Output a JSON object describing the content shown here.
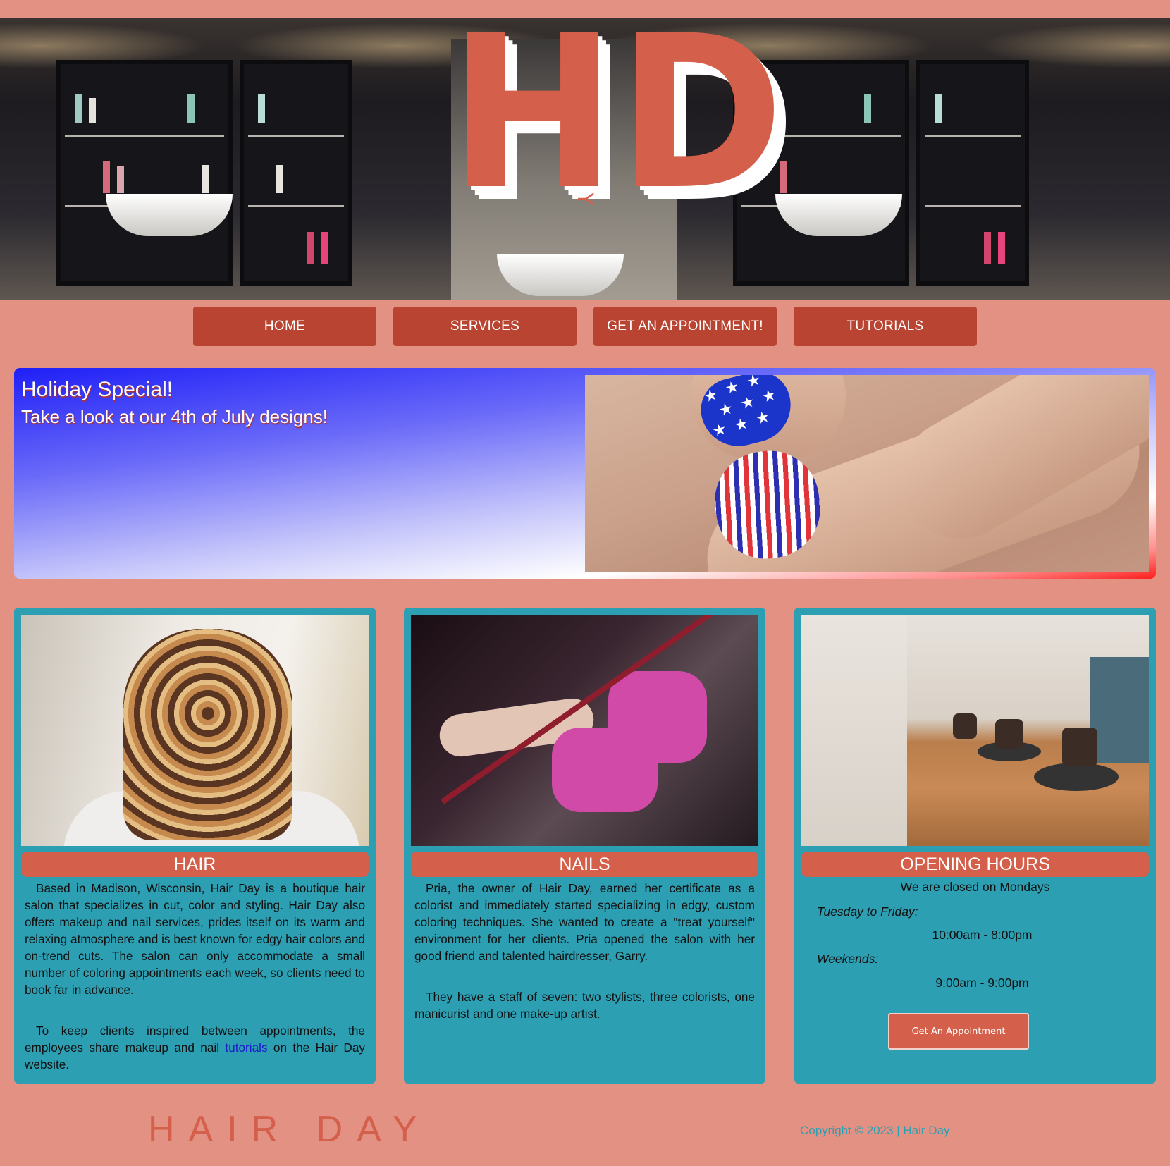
{
  "brand": {
    "logo_h": "H",
    "logo_d": "D",
    "logo_sub": "HAIR DAY"
  },
  "nav": [
    {
      "label": "HOME"
    },
    {
      "label": "SERVICES"
    },
    {
      "label": "GET AN APPOINTMENT!"
    },
    {
      "label": "TUTORIALS"
    }
  ],
  "promo": {
    "title": "Holiday Special!",
    "subtitle": "Take a look at our 4th of July designs!"
  },
  "hair": {
    "heading": "HAIR",
    "p1": "Based in Madison, Wisconsin, Hair Day is a boutique hair salon that specializes in cut, color and styling. Hair Day also offers makeup and nail services, prides itself on its warm and relaxing atmosphere and is best known for edgy hair colors and on-trend cuts. The salon can only accommodate a small number of coloring appointments each week, so clients need to book far in advance.",
    "p2_before": "To keep clients inspired between appointments, the employees share makeup and nail ",
    "p2_link": "tutorials",
    "p2_after": " on the Hair Day website."
  },
  "nails": {
    "heading": "NAILS",
    "p1": "Pria, the owner of Hair Day, earned her certificate as a colorist and immediately started specializing in edgy, custom coloring techniques. She wanted to create a \"treat yourself\" environment for her clients. Pria opened the salon with her good friend and talented hairdresser, Garry.",
    "p2": "They have a staff of seven: two stylists, three colorists, one manicurist and one make-up artist."
  },
  "hours": {
    "heading": "OPENING HOURS",
    "closed": "We are closed on Mondays",
    "weekday_label": "Tuesday to Friday:",
    "weekday_hours": "10:00am - 8:00pm",
    "weekend_label": "Weekends:",
    "weekend_hours": "9:00am - 9:00pm",
    "button": "Get An Appointment"
  },
  "footer": {
    "brand": "HAIR DAY",
    "copyright": "Copyright © 2023 | Hair Day"
  },
  "colors": {
    "background": "#e29183",
    "accent": "#d45f4b",
    "nav_button": "#b94432",
    "card": "#2d9fb3"
  }
}
